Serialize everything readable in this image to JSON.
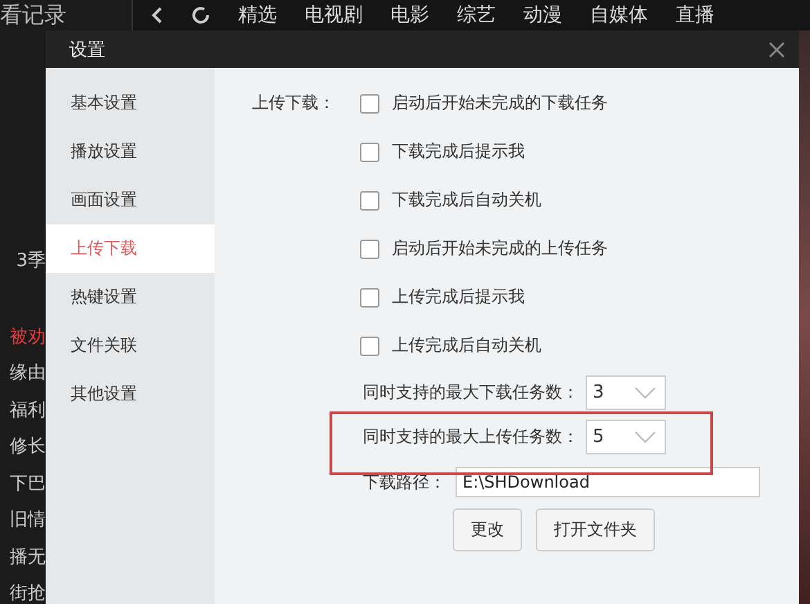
{
  "background": {
    "history_label": "看记录",
    "nav_tabs": [
      "精选",
      "电视剧",
      "电影",
      "综艺",
      "动漫",
      "自媒体",
      "直播"
    ],
    "list_items": [
      {
        "text": "3季",
        "highlighted": false
      },
      {
        "text": "被劝",
        "highlighted": true
      },
      {
        "text": "缘由",
        "highlighted": false
      },
      {
        "text": "福利",
        "highlighted": false
      },
      {
        "text": "修长",
        "highlighted": false
      },
      {
        "text": "下巴",
        "highlighted": false
      },
      {
        "text": "旧情",
        "highlighted": false
      },
      {
        "text": "播无",
        "highlighted": false
      },
      {
        "text": "街抢",
        "highlighted": false
      }
    ]
  },
  "dialog": {
    "title": "设置",
    "sidebar": [
      {
        "label": "基本设置",
        "selected": false
      },
      {
        "label": "播放设置",
        "selected": false
      },
      {
        "label": "画面设置",
        "selected": false
      },
      {
        "label": "上传下载",
        "selected": true
      },
      {
        "label": "热键设置",
        "selected": false
      },
      {
        "label": "文件关联",
        "selected": false
      },
      {
        "label": "其他设置",
        "selected": false
      }
    ],
    "section_label": "上传下载：",
    "options": [
      {
        "label": "启动后开始未完成的下载任务",
        "checked": false
      },
      {
        "label": "下载完成后提示我",
        "checked": false
      },
      {
        "label": "下载完成后自动关机",
        "checked": false
      },
      {
        "label": "启动后开始未完成的上传任务",
        "checked": false
      },
      {
        "label": "上传完成后提示我",
        "checked": false
      },
      {
        "label": "上传完成后自动关机",
        "checked": false
      }
    ],
    "limits": [
      {
        "label": "同时支持的最大下载任务数：",
        "value": "3",
        "highlighted": false
      },
      {
        "label": "同时支持的最大上传任务数：",
        "value": "5",
        "highlighted": true
      }
    ],
    "download_path": {
      "label": "下载路径：",
      "value": "E:\\SHDownload"
    },
    "buttons": [
      "更改",
      "打开文件夹"
    ]
  }
}
